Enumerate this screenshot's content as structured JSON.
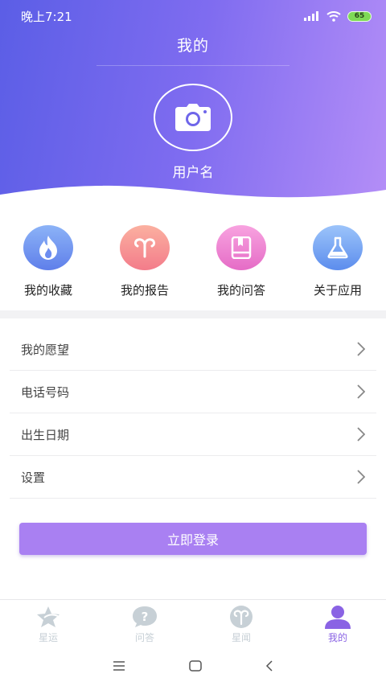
{
  "status_bar": {
    "time": "晚上7:21",
    "battery": "65"
  },
  "header": {
    "title": "我的",
    "username": "用户名"
  },
  "features": [
    {
      "label": "我的收藏",
      "icon": "flame-icon",
      "color": "#6d8df0"
    },
    {
      "label": "我的报告",
      "icon": "aries-icon",
      "color": "#f6908c"
    },
    {
      "label": "我的问答",
      "icon": "book-icon",
      "color": "#f07fd0"
    },
    {
      "label": "关于应用",
      "icon": "flask-icon",
      "color": "#6f9ff2"
    }
  ],
  "menu": [
    {
      "label": "我的愿望"
    },
    {
      "label": "电话号码"
    },
    {
      "label": "出生日期"
    },
    {
      "label": "设置"
    }
  ],
  "login_button": "立即登录",
  "tabs": [
    {
      "label": "星运",
      "icon": "star-icon",
      "active": false
    },
    {
      "label": "问答",
      "icon": "question-icon",
      "active": false
    },
    {
      "label": "星闻",
      "icon": "aries-icon",
      "active": false
    },
    {
      "label": "我的",
      "icon": "user-icon",
      "active": true
    }
  ],
  "colors": {
    "accent": "#a980f2",
    "header_start": "#5b5ee6",
    "header_end": "#b48ef7",
    "tab_active": "#8a63e4",
    "tab_inactive": "#c7d0d6"
  }
}
